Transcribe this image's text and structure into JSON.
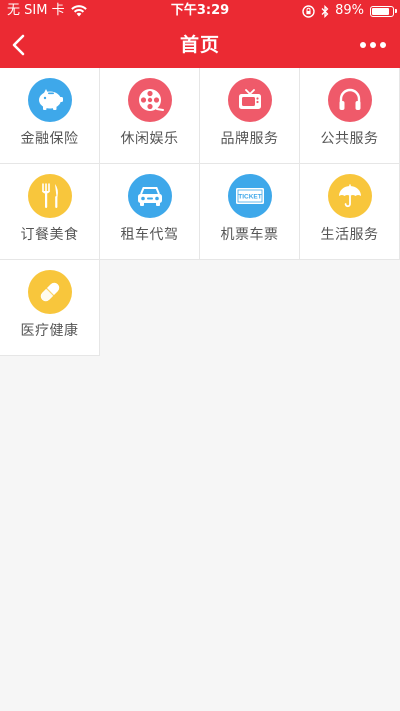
{
  "status_bar": {
    "carrier": "无 SIM 卡",
    "time": "下午3:29",
    "battery_percent_text": "89%",
    "battery_level": 0.89
  },
  "nav": {
    "title": "首页"
  },
  "colors": {
    "brand_red": "#eb2a33",
    "blue": "#3ea8ea",
    "pink": "#ef5a6a",
    "yellow": "#f8c63c"
  },
  "grid": {
    "items": [
      {
        "label": "金融保险",
        "icon": "piggy-bank-icon",
        "color": "#3ea8ea"
      },
      {
        "label": "休闲娱乐",
        "icon": "film-reel-icon",
        "color": "#ef5a6a"
      },
      {
        "label": "品牌服务",
        "icon": "tv-icon",
        "color": "#ef5a6a"
      },
      {
        "label": "公共服务",
        "icon": "headphones-icon",
        "color": "#ef5a6a"
      },
      {
        "label": "订餐美食",
        "icon": "fork-knife-icon",
        "color": "#f8c63c"
      },
      {
        "label": "租车代驾",
        "icon": "car-icon",
        "color": "#3ea8ea"
      },
      {
        "label": "机票车票",
        "icon": "ticket-icon",
        "color": "#3ea8ea",
        "icon_text": "TICKET"
      },
      {
        "label": "生活服务",
        "icon": "umbrella-icon",
        "color": "#f8c63c"
      },
      {
        "label": "医疗健康",
        "icon": "pill-icon",
        "color": "#f8c63c"
      }
    ]
  }
}
